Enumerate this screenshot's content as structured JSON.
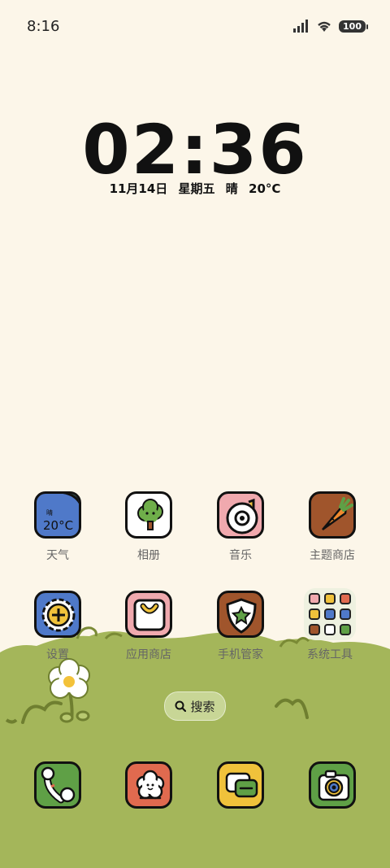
{
  "status_bar": {
    "time": "8:16",
    "battery": "100"
  },
  "clock": {
    "time": "02:36",
    "date": "11月14日",
    "weekday": "星期五",
    "weather": "晴",
    "temperature": "20°C"
  },
  "weather_icon": {
    "condition": "晴",
    "temperature": "20°C"
  },
  "apps_row1": [
    {
      "label": "天气",
      "icon": "weather-icon"
    },
    {
      "label": "相册",
      "icon": "gallery-icon"
    },
    {
      "label": "音乐",
      "icon": "music-icon"
    },
    {
      "label": "主题商店",
      "icon": "theme-store-icon"
    }
  ],
  "apps_row2": [
    {
      "label": "设置",
      "icon": "settings-icon"
    },
    {
      "label": "应用商店",
      "icon": "app-store-icon"
    },
    {
      "label": "手机管家",
      "icon": "security-icon"
    },
    {
      "label": "系统工具",
      "icon": "system-tools-folder"
    }
  ],
  "search": {
    "label": "搜索"
  },
  "dock": [
    {
      "icon": "phone-icon"
    },
    {
      "icon": "contacts-icon"
    },
    {
      "icon": "messages-icon"
    },
    {
      "icon": "camera-icon"
    }
  ],
  "colors": {
    "background": "#fcf6e9",
    "grass": "#a4b65a",
    "outline": "#111111"
  }
}
